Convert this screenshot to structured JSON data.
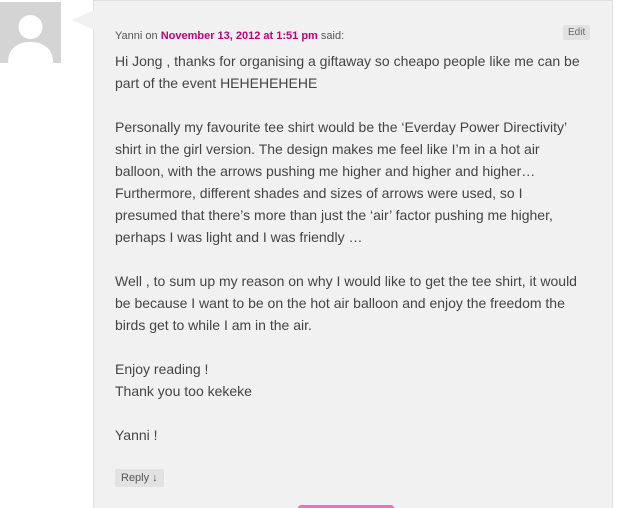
{
  "comment": {
    "author": "Yanni",
    "on_text": " on ",
    "date_link": "November 13, 2012 at 1:51 pm",
    "said_text": " said:",
    "edit_label": "Edit",
    "paragraphs": [
      "Hi Jong , thanks for organising a giftaway so cheapo people like me can be\npart of the event HEHEHEHEHE",
      "Personally my favourite tee shirt would be the ‘Everday Power Directivity’\nshirt in the girl version. The design makes me feel like I’m in a hot air\nballoon, with the arrows pushing me higher and higher and higher…\nFurthermore, different shades and sizes of arrows were used, so I\npresumed that there’s more than just the ‘air’ factor pushing me higher,\nperhaps I was light and I was friendly …",
      "Well , to sum up my reason on why I would like to get the tee shirt, it would\nbe because I want to be on the hot air balloon and enjoy the freedom the\nbirds get to while I am in the air.",
      "Enjoy reading !\nThank you too kekeke",
      "Yanni !"
    ],
    "reply_label": "Reply ↓"
  },
  "avatar_icon": "default-user-avatar-icon",
  "colors": {
    "link": "#c0007a",
    "bubble_bg": "#f1f1f1",
    "text": "#444444",
    "accent": "#f06ec0"
  }
}
